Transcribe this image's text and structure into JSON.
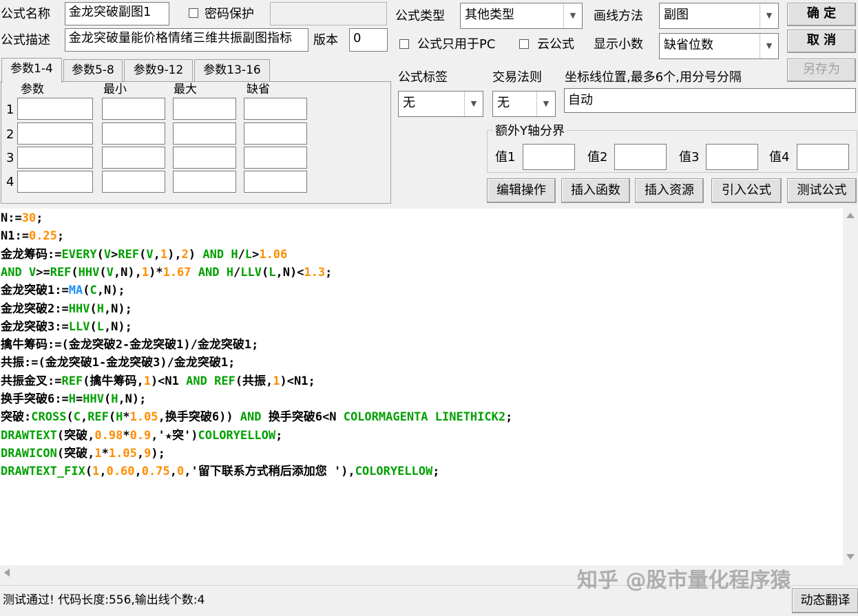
{
  "top": {
    "name_label": "公式名称",
    "name_value": "金龙突破副图1",
    "password_label": "密码保护",
    "password_value": "",
    "desc_label": "公式描述",
    "desc_value": "金龙突破量能价格情绪三维共振副图指标",
    "version_label": "版本",
    "version_value": "0",
    "type_label": "公式类型",
    "type_value": "其他类型",
    "draw_label": "画线方法",
    "draw_value": "副图",
    "ok_button": "确 定",
    "cancel_button": "取 消",
    "saveas_button": "另存为",
    "pc_only_label": "公式只用于PC",
    "cloud_label": "云公式",
    "decimals_label": "显示小数",
    "decimals_value": "缺省位数"
  },
  "tabs": [
    "参数1-4",
    "参数5-8",
    "参数9-12",
    "参数13-16"
  ],
  "params": {
    "headers": [
      "参数",
      "最小",
      "最大",
      "缺省"
    ],
    "rows": [
      "1",
      "2",
      "3",
      "4"
    ]
  },
  "right": {
    "tag_label": "公式标签",
    "tag_value": "无",
    "rule_label": "交易法则",
    "rule_value": "无",
    "axis_label": "坐标线位置,最多6个,用分号分隔",
    "axis_value": "自动",
    "yaxis_group": "额外Y轴分界",
    "v1": "值1",
    "v2": "值2",
    "v3": "值3",
    "v4": "值4"
  },
  "actions": [
    "编辑操作",
    "插入函数",
    "插入资源",
    "引入公式",
    "测试公式"
  ],
  "code_lines": [
    [
      [
        "t",
        "N:="
      ],
      [
        "n",
        "30"
      ],
      [
        "t",
        ";"
      ]
    ],
    [
      [
        "t",
        "N1:="
      ],
      [
        "n",
        "0.25"
      ],
      [
        "t",
        ";"
      ]
    ],
    [
      [
        "t",
        "金龙筹码:="
      ],
      [
        "f",
        "EVERY"
      ],
      [
        "t",
        "("
      ],
      [
        "f",
        "V"
      ],
      [
        "t",
        ">"
      ],
      [
        "f",
        "REF"
      ],
      [
        "t",
        "("
      ],
      [
        "f",
        "V"
      ],
      [
        "t",
        ","
      ],
      [
        "n",
        "1"
      ],
      [
        "t",
        "),"
      ],
      [
        "n",
        "2"
      ],
      [
        "t",
        ") "
      ],
      [
        "k",
        "AND"
      ],
      [
        "t",
        " "
      ],
      [
        "f",
        "H"
      ],
      [
        "t",
        "/"
      ],
      [
        "f",
        "L"
      ],
      [
        "t",
        ">"
      ],
      [
        "n",
        "1.06"
      ]
    ],
    [
      [
        "k",
        "AND"
      ],
      [
        "t",
        " "
      ],
      [
        "f",
        "V"
      ],
      [
        "t",
        ">="
      ],
      [
        "f",
        "REF"
      ],
      [
        "t",
        "("
      ],
      [
        "f",
        "HHV"
      ],
      [
        "t",
        "("
      ],
      [
        "f",
        "V"
      ],
      [
        "t",
        ",N),"
      ],
      [
        "n",
        "1"
      ],
      [
        "t",
        ")*"
      ],
      [
        "n",
        "1.67"
      ],
      [
        "t",
        " "
      ],
      [
        "k",
        "AND"
      ],
      [
        "t",
        " "
      ],
      [
        "f",
        "H"
      ],
      [
        "t",
        "/"
      ],
      [
        "f",
        "LLV"
      ],
      [
        "t",
        "("
      ],
      [
        "f",
        "L"
      ],
      [
        "t",
        ",N)<"
      ],
      [
        "n",
        "1.3"
      ],
      [
        "t",
        ";"
      ]
    ],
    [
      [
        "t",
        "金龙突破1:="
      ],
      [
        "b",
        "MA"
      ],
      [
        "t",
        "("
      ],
      [
        "f",
        "C"
      ],
      [
        "t",
        ",N);"
      ]
    ],
    [
      [
        "t",
        "金龙突破2:="
      ],
      [
        "f",
        "HHV"
      ],
      [
        "t",
        "("
      ],
      [
        "f",
        "H"
      ],
      [
        "t",
        ",N);"
      ]
    ],
    [
      [
        "t",
        "金龙突破3:="
      ],
      [
        "f",
        "LLV"
      ],
      [
        "t",
        "("
      ],
      [
        "f",
        "L"
      ],
      [
        "t",
        ",N);"
      ]
    ],
    [
      [
        "t",
        "擒牛筹码:=(金龙突破2-金龙突破1)/金龙突破1;"
      ]
    ],
    [
      [
        "t",
        "共振:=(金龙突破1-金龙突破3)/金龙突破1;"
      ]
    ],
    [
      [
        "t",
        "共振金叉:="
      ],
      [
        "f",
        "REF"
      ],
      [
        "t",
        "(擒牛筹码,"
      ],
      [
        "n",
        "1"
      ],
      [
        "t",
        ")<N1 "
      ],
      [
        "k",
        "AND"
      ],
      [
        "t",
        " "
      ],
      [
        "f",
        "REF"
      ],
      [
        "t",
        "(共振,"
      ],
      [
        "n",
        "1"
      ],
      [
        "t",
        ")<N1;"
      ]
    ],
    [
      [
        "t",
        "换手突破6:="
      ],
      [
        "f",
        "H"
      ],
      [
        "t",
        "="
      ],
      [
        "f",
        "HHV"
      ],
      [
        "t",
        "("
      ],
      [
        "f",
        "H"
      ],
      [
        "t",
        ",N);"
      ]
    ],
    [
      [
        "t",
        "突破:"
      ],
      [
        "f",
        "CROSS"
      ],
      [
        "t",
        "("
      ],
      [
        "f",
        "C"
      ],
      [
        "t",
        ","
      ],
      [
        "f",
        "REF"
      ],
      [
        "t",
        "("
      ],
      [
        "f",
        "H"
      ],
      [
        "t",
        "*"
      ],
      [
        "n",
        "1.05"
      ],
      [
        "t",
        ",换手突破6)) "
      ],
      [
        "k",
        "AND"
      ],
      [
        "t",
        " 换手突破6<N "
      ],
      [
        "k",
        "COLORMAGENTA LINETHICK2"
      ],
      [
        "t",
        ";"
      ]
    ],
    [
      [
        "f",
        "DRAWTEXT"
      ],
      [
        "t",
        "(突破,"
      ],
      [
        "n",
        "0.98"
      ],
      [
        "t",
        "*"
      ],
      [
        "n",
        "0.9"
      ],
      [
        "t",
        ",'★突')"
      ],
      [
        "k",
        "COLORYELLOW"
      ],
      [
        "t",
        ";"
      ]
    ],
    [
      [
        "f",
        "DRAWICON"
      ],
      [
        "t",
        "(突破,"
      ],
      [
        "n",
        "1"
      ],
      [
        "t",
        "*"
      ],
      [
        "n",
        "1.05"
      ],
      [
        "t",
        ","
      ],
      [
        "n",
        "9"
      ],
      [
        "t",
        ");"
      ]
    ],
    [
      [
        "f",
        "DRAWTEXT_FIX"
      ],
      [
        "t",
        "("
      ],
      [
        "n",
        "1"
      ],
      [
        "t",
        ","
      ],
      [
        "n",
        "0.60"
      ],
      [
        "t",
        ","
      ],
      [
        "n",
        "0.75"
      ],
      [
        "t",
        ","
      ],
      [
        "n",
        "0"
      ],
      [
        "t",
        ",'留下联系方式稍后添加您 '),"
      ],
      [
        "k",
        "COLORYELLOW"
      ],
      [
        "t",
        ";"
      ]
    ]
  ],
  "status": {
    "text": "测试通过! 代码长度:556,输出线个数:4",
    "translate_button": "动态翻译",
    "watermark": "知乎 @股市量化程序猿"
  },
  "colors": {
    "keyword": "#00a000",
    "number": "#ff8c00",
    "builtin": "#1e90ff",
    "text": "#000000"
  }
}
